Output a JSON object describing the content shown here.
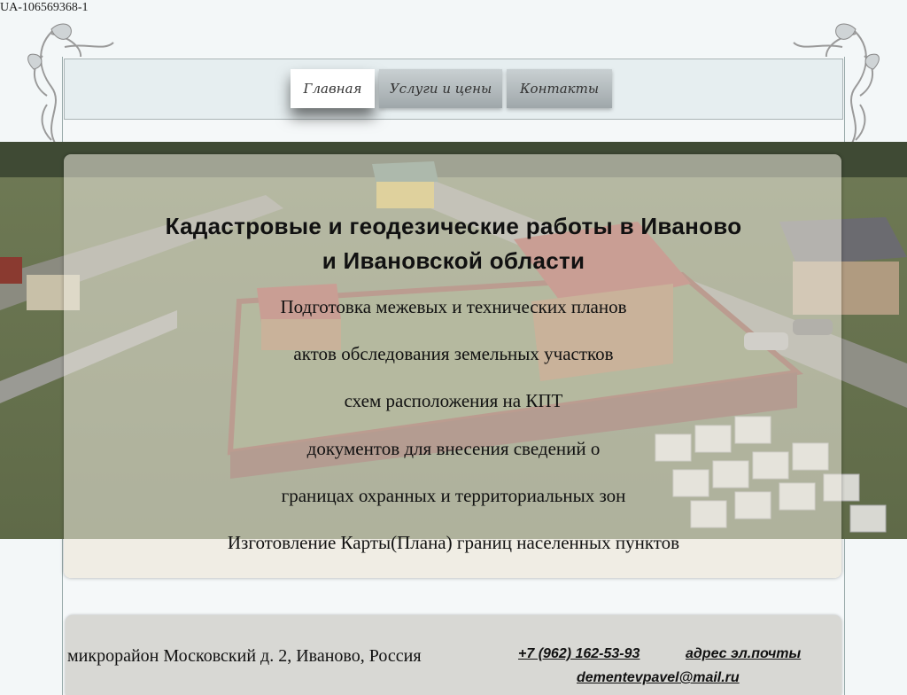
{
  "tracking_id": "UA-106569368-1",
  "nav": {
    "items": [
      {
        "label": "Главная",
        "active": true
      },
      {
        "label": "Услуги и цены",
        "active": false
      },
      {
        "label": "Контакты",
        "active": false
      }
    ]
  },
  "hero": {
    "title_line1": "Кадастровые и геодезические работы в Иваново",
    "title_line2": "и Ивановской области",
    "services": [
      "Подготовка межевых и технических планов",
      "актов обследования земельных участков",
      "схем расположения на КПТ",
      "документов для внесения сведений о",
      "границах охранных и территориальных зон",
      "Изготовление Карты(Плана) границ населенных пунктов"
    ]
  },
  "footer": {
    "address": "микрорайон Московский д. 2,  Иваново,  Россия",
    "phone": "+7 (962) 162-53-93",
    "email_label": "адрес эл.почты",
    "email": "dementevpavel@mail.ru"
  },
  "colors": {
    "background": "#f3f7f8",
    "nav_bar": "#e6eef0",
    "card": "#f0ede4",
    "footer": "#d8d8d4"
  }
}
